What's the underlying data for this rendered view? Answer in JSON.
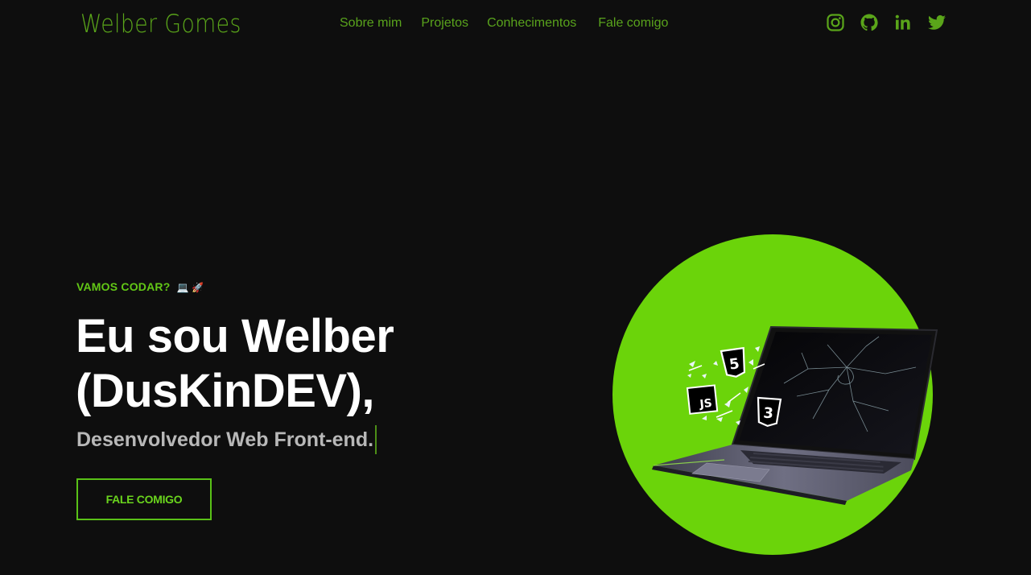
{
  "brand": {
    "name": "Welber Gomes"
  },
  "nav": {
    "items": [
      {
        "label": "Sobre mim"
      },
      {
        "label": "Projetos"
      },
      {
        "label": "Conhecimentos"
      },
      {
        "label": "Fale comigo"
      }
    ]
  },
  "social": {
    "icons": [
      "instagram-icon",
      "github-icon",
      "linkedin-icon",
      "twitter-icon"
    ],
    "linkedin_text": "in"
  },
  "hero": {
    "eyebrow": "VAMOS CODAR?",
    "eyebrow_emoji": "💻 🚀",
    "headline_line1": "Eu sou Welber",
    "headline_line2": "(DusKinDEV),",
    "subtitle": "Desenvolvedor Web Front-end.",
    "cta_label": "FALE COMIGO"
  },
  "illustration": {
    "badges": {
      "html": "5",
      "js": "JS",
      "css": "3"
    }
  },
  "colors": {
    "background": "#0e0e0e",
    "accent": "#6ad41d",
    "nav_text": "#59a31c",
    "circle": "#6bd40a",
    "headline": "#ffffff",
    "subtitle": "#b8b8b8"
  }
}
